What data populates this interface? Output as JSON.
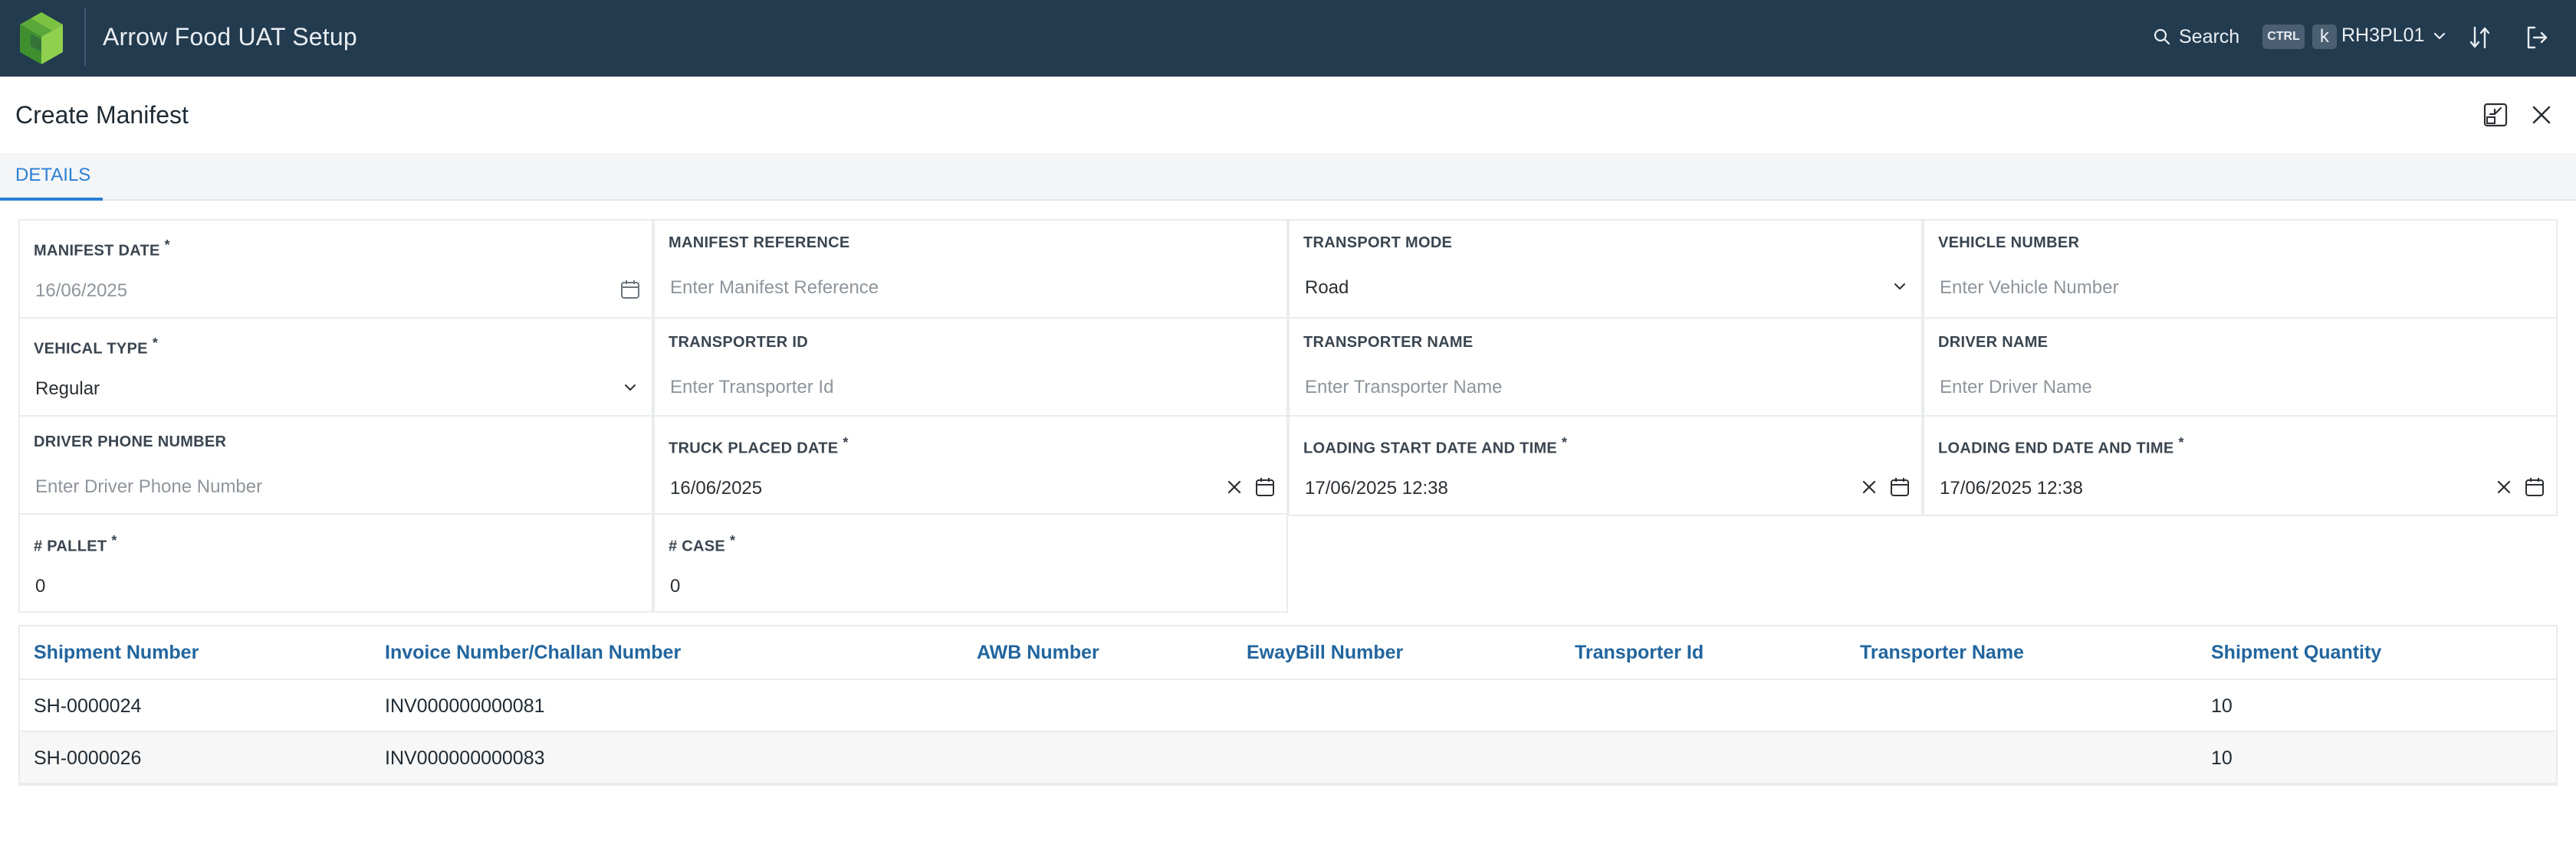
{
  "app": {
    "title": "Arrow Food UAT Setup",
    "search_label": "Search",
    "shortcut_ctrl": "CTRL",
    "shortcut_key": "k",
    "user": "RH3PL01",
    "colors": {
      "topbar": "#233b4f",
      "accent": "#2a7fd4",
      "table_header": "#22659e"
    }
  },
  "page": {
    "title": "Create Manifest",
    "tabs": [
      {
        "label": "DETAILS",
        "active": true
      }
    ]
  },
  "form": {
    "manifest_date": {
      "label": "MANIFEST DATE",
      "required": "*",
      "value": "16/06/2025"
    },
    "manifest_reference": {
      "label": "MANIFEST REFERENCE",
      "placeholder": "Enter Manifest Reference"
    },
    "transport_mode": {
      "label": "TRANSPORT MODE",
      "value": "Road"
    },
    "vehicle_number": {
      "label": "VEHICLE NUMBER",
      "placeholder": "Enter Vehicle Number"
    },
    "vehical_type": {
      "label": "VEHICAL TYPE",
      "required": "*",
      "value": "Regular"
    },
    "transporter_id": {
      "label": "TRANSPORTER ID",
      "placeholder": "Enter Transporter Id"
    },
    "transporter_name": {
      "label": "TRANSPORTER NAME",
      "placeholder": "Enter Transporter Name"
    },
    "driver_name": {
      "label": "DRIVER NAME",
      "placeholder": "Enter Driver Name"
    },
    "driver_phone": {
      "label": "DRIVER PHONE NUMBER",
      "placeholder": "Enter Driver Phone Number"
    },
    "truck_placed_date": {
      "label": "TRUCK PLACED DATE",
      "required": "*",
      "value": "16/06/2025"
    },
    "loading_start": {
      "label": "LOADING START DATE AND TIME",
      "required": "*",
      "value": "17/06/2025 12:38"
    },
    "loading_end": {
      "label": "LOADING END DATE AND TIME",
      "required": "*",
      "value": "17/06/2025 12:38"
    },
    "pallet": {
      "label": "# PALLET",
      "required": "*",
      "value": "0"
    },
    "case": {
      "label": "# CASE",
      "required": "*",
      "value": "0"
    }
  },
  "table": {
    "columns": [
      "Shipment Number",
      "Invoice Number/Challan Number",
      "AWB Number",
      "EwayBill Number",
      "Transporter Id",
      "Transporter Name",
      "Shipment Quantity"
    ],
    "rows": [
      [
        "SH-0000024",
        "INV000000000081",
        "",
        "",
        "",
        "",
        "10"
      ],
      [
        "SH-0000026",
        "INV000000000083",
        "",
        "",
        "",
        "",
        "10"
      ]
    ]
  },
  "icons": {
    "logo": "arrow-food-logo",
    "search": "search-icon",
    "chevron": "chevron-down-icon",
    "sort": "sort-icon",
    "logout": "logout-icon",
    "collapse": "collapse-icon",
    "close": "close-icon",
    "calendar": "calendar-icon",
    "clear": "clear-icon"
  }
}
